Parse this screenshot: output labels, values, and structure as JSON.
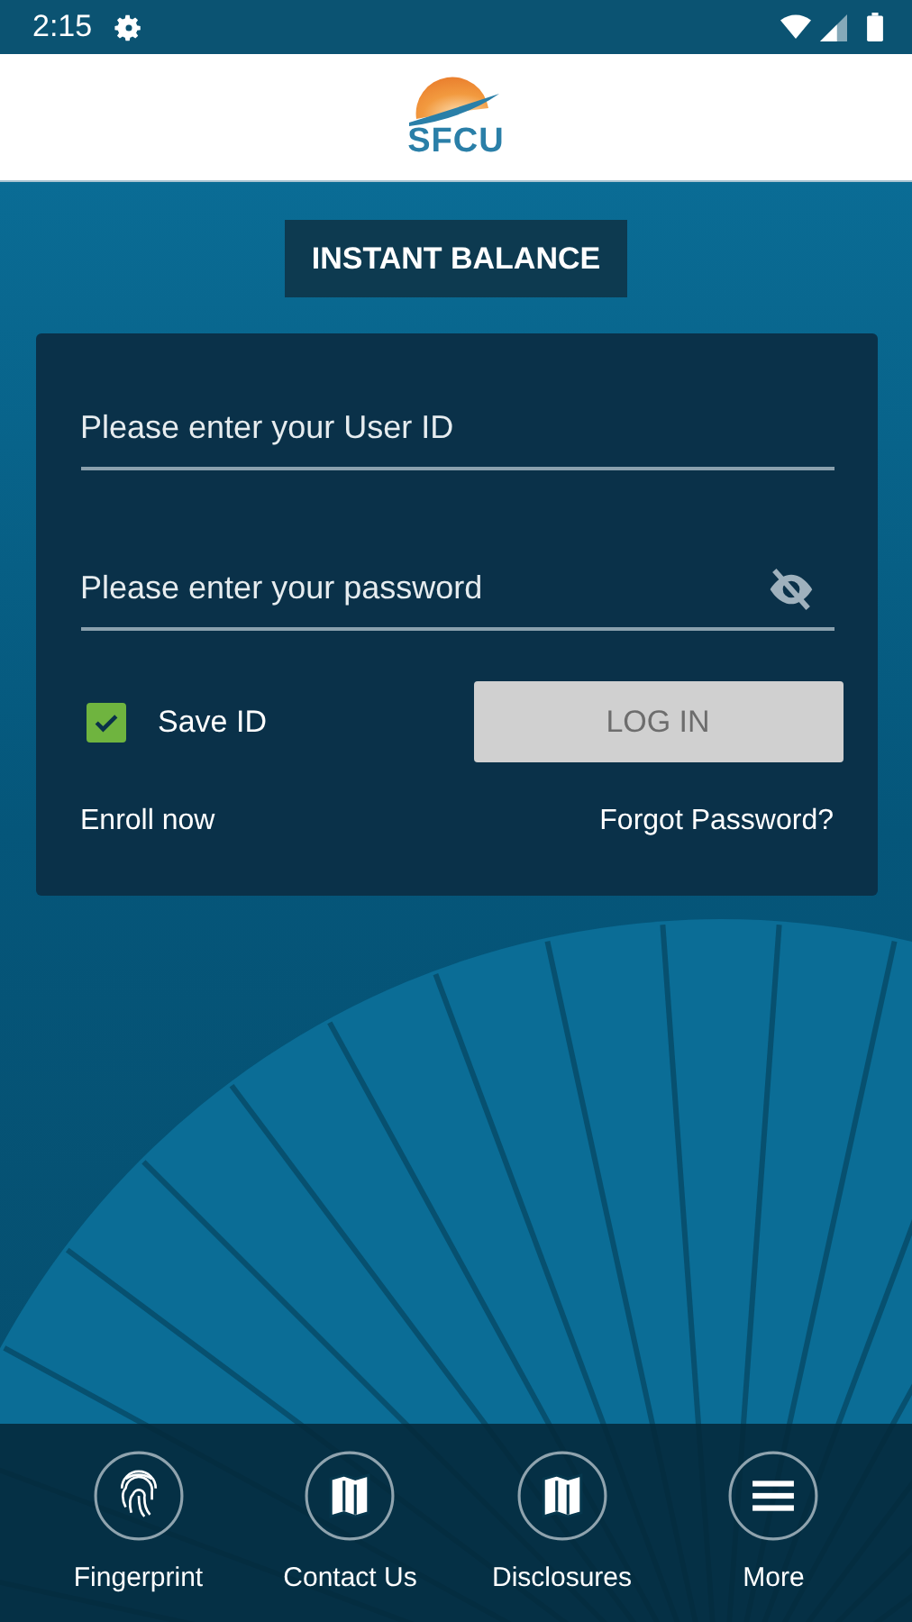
{
  "status_bar": {
    "time": "2:15"
  },
  "header": {
    "logo_text": "SFCU"
  },
  "instant_balance": {
    "label": "INSTANT BALANCE"
  },
  "login": {
    "user_id": {
      "placeholder": "Please enter your User ID"
    },
    "password": {
      "placeholder": "Please enter your password",
      "visible": false
    },
    "save_id": {
      "label": "Save ID",
      "checked": true
    },
    "login_button": {
      "label": "LOG IN",
      "disabled": true
    },
    "enroll_link": "Enroll now",
    "forgot_link": "Forgot Password?"
  },
  "bottom_nav": [
    {
      "label": "Fingerprint",
      "kind": "fingerprint"
    },
    {
      "label": "Contact Us",
      "kind": "map"
    },
    {
      "label": "Disclosures",
      "kind": "map"
    },
    {
      "label": "More",
      "kind": "menu"
    }
  ]
}
